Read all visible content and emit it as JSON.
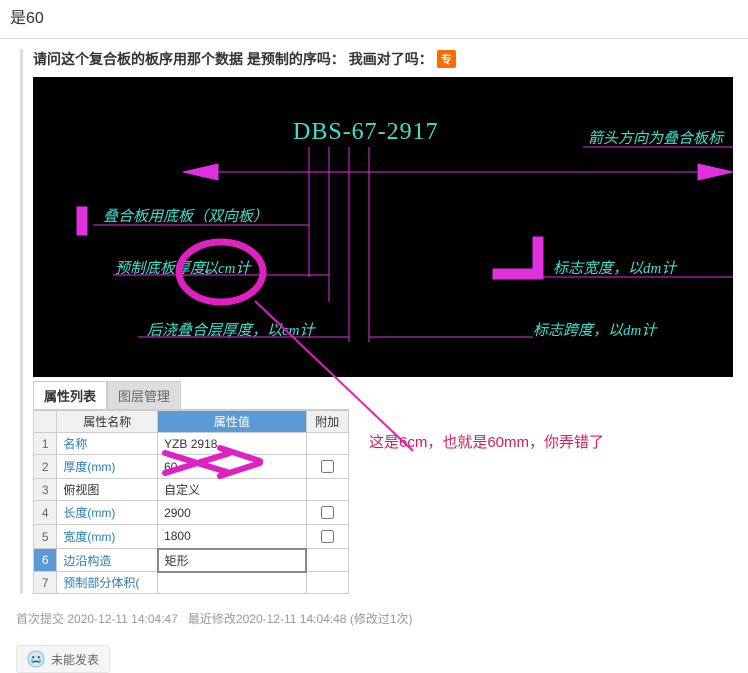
{
  "header_text": "是60",
  "question_text": "请问这个复合板的板序用那个数据 是预制的序吗： 我画对了吗：",
  "badge": "专",
  "cad": {
    "title": "DBS-67-2917",
    "label_topright": "箭头方向为叠合板标",
    "label_1": "叠合板用底板（双向板）",
    "label_2_prefix": "预制底板厚度,",
    "label_2_circled": "以cm计",
    "label_3": "后浇叠合层厚度，以cm计",
    "label_4": "标志宽度，以dm计",
    "label_5": "标志跨度，以dm计"
  },
  "tabs": {
    "t1": "属性列表",
    "t2": "图层管理"
  },
  "table": {
    "headers": {
      "name": "属性名称",
      "value": "属性值",
      "extra": "附加"
    },
    "rows": [
      {
        "num": "1",
        "name": "名称",
        "value": "YZB 2918",
        "link": true,
        "checkbox": false
      },
      {
        "num": "2",
        "name": "厚度(mm)",
        "value": "60",
        "link": true,
        "checkbox": true,
        "scribble": true
      },
      {
        "num": "3",
        "name": "俯视图",
        "value": "自定义",
        "link": false,
        "checkbox": false
      },
      {
        "num": "4",
        "name": "长度(mm)",
        "value": "2900",
        "link": true,
        "checkbox": true
      },
      {
        "num": "5",
        "name": "宽度(mm)",
        "value": "1800",
        "link": true,
        "checkbox": true
      },
      {
        "num": "6",
        "name": "边沿构造",
        "value": "矩形",
        "link": true,
        "checkbox": false,
        "selected": true
      },
      {
        "num": "7",
        "name": "预制部分体积(",
        "value": "",
        "link": true,
        "checkbox": false
      }
    ]
  },
  "annotation_text": "这是6cm，也就是60mm，你弄错了",
  "meta": {
    "first_submit_label": "首次提交",
    "first_submit_time": "2020-12-11 14:04:47",
    "last_modified_label": "最近修改",
    "last_modified_time": "2020-12-11 14:04:48",
    "modified_count": "(修改过1次)"
  },
  "status_text": "未能发表"
}
